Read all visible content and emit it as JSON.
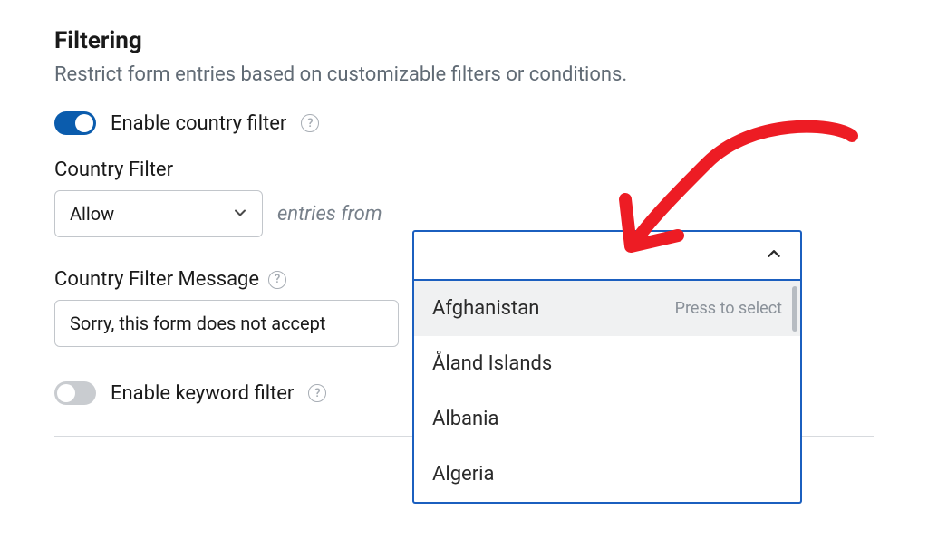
{
  "section": {
    "title": "Filtering",
    "description": "Restrict form entries based on customizable filters or conditions."
  },
  "country_filter_toggle": {
    "label": "Enable country filter",
    "enabled": true
  },
  "country_filter": {
    "label": "Country Filter",
    "mode_selected": "Allow",
    "entries_text": "entries from",
    "press_to_select": "Press to select",
    "options": {
      "o1": "Afghanistan",
      "o2": "Åland Islands",
      "o3": "Albania",
      "o4": "Algeria"
    }
  },
  "country_filter_message": {
    "label": "Country Filter Message",
    "value": "Sorry, this form does not accept"
  },
  "keyword_filter_toggle": {
    "label": "Enable keyword filter",
    "enabled": false
  }
}
